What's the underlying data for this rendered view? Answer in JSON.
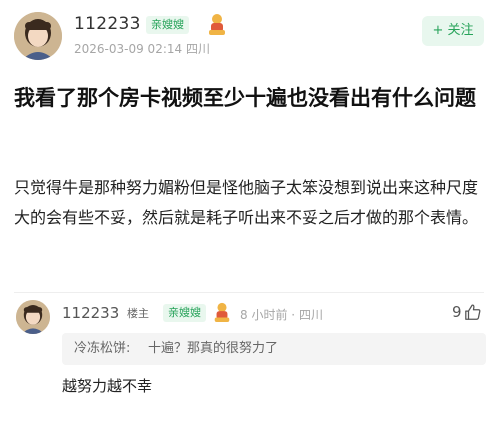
{
  "post": {
    "author": "112233",
    "badge": "亲嫂嫂",
    "timestamp": "2026-03-09 02:14",
    "location": "四川",
    "follow_label": "+ 关注",
    "title": "我看了那个房卡视频至少十遍也没看出有什么问题",
    "body": "只觉得牛是那种努力媚粉但是怪他脑子太笨没想到说出来这种尺度大的会有些不妥，然后就是耗子听出来不妥之后才做的那个表情。"
  },
  "comment": {
    "author": "112233",
    "op_tag": "楼主",
    "badge": "亲嫂嫂",
    "time": "8 小时前",
    "separator": "·",
    "location": "四川",
    "likes": "9",
    "quote_author": "冷冻松饼:",
    "quote_text": "十遍？那真的很努力了",
    "reply": "越努力越不幸"
  },
  "colors": {
    "accent": "#27a35a",
    "badge_bg": "#e9f7ee"
  }
}
